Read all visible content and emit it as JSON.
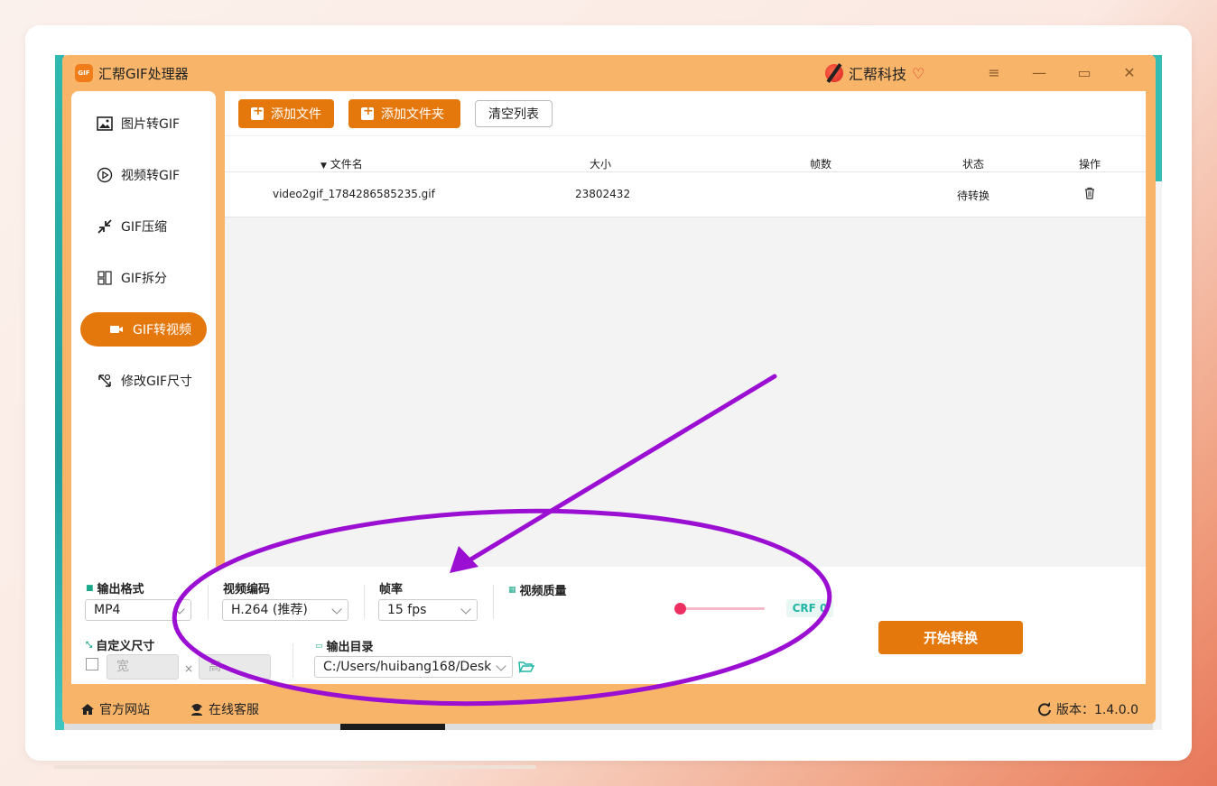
{
  "app": {
    "title": "汇帮GIF处理器",
    "logo_text": "GIF",
    "brand": "汇帮科技",
    "version_label": "版本：1.4.0.0"
  },
  "colors": {
    "accent": "#e5780d",
    "app_bg": "#f8b56a",
    "annotation": "#9b0fd2",
    "crf": "#20b5a5",
    "slider": "#ee2f62"
  },
  "sidebar": {
    "items": [
      {
        "label": "图片转GIF",
        "icon": "image-icon",
        "active": false
      },
      {
        "label": "视频转GIF",
        "icon": "play-icon",
        "active": false
      },
      {
        "label": "GIF压缩",
        "icon": "compress-icon",
        "active": false
      },
      {
        "label": "GIF拆分",
        "icon": "split-icon",
        "active": false
      },
      {
        "label": "GIF转视频",
        "icon": "video-camera-icon",
        "active": true
      },
      {
        "label": "修改GIF尺寸",
        "icon": "resize-icon",
        "active": false
      }
    ]
  },
  "toolbar": {
    "add_file": "添加文件",
    "add_folder": "添加文件夹",
    "clear_list": "清空列表"
  },
  "table": {
    "headers": {
      "filename": "文件名",
      "size": "大小",
      "frames": "帧数",
      "status": "状态",
      "action": "操作"
    },
    "rows": [
      {
        "filename": "video2gif_1784286585235.gif",
        "size": "23802432",
        "frames": "",
        "status": "待转换"
      }
    ]
  },
  "settings": {
    "output_format_label": "输出格式",
    "output_format_value": "MP4",
    "codec_label": "视频编码",
    "codec_value": "H.264 (推荐)",
    "fps_label": "帧率",
    "fps_value": "15 fps",
    "quality_label": "视频质量",
    "quality_fraction": 0.0,
    "crf_label": "CRF 0",
    "custom_size_label": "自定义尺寸",
    "width_placeholder": "宽",
    "height_placeholder": "高",
    "times": "×",
    "output_dir_label": "输出目录",
    "output_dir_value": "C:/Users/huibang168/Desk",
    "start_button": "开始转换"
  },
  "footer": {
    "website": "官方网站",
    "support": "在线客服"
  }
}
